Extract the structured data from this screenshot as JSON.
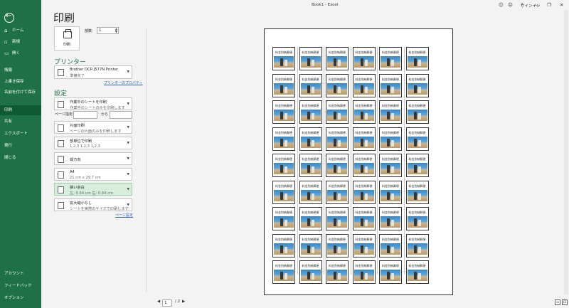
{
  "titlebar": {
    "title": "Book1 - Excel",
    "signin": "サインイン",
    "icons": [
      "smiley-icon",
      "frown-icon",
      "help-icon",
      "minimize-icon",
      "restore-icon",
      "close-icon"
    ],
    "glyphs": [
      "☺",
      "☹",
      "?",
      "—",
      "❐",
      "✕"
    ]
  },
  "sidebar": {
    "back_glyph": "",
    "items": [
      {
        "label": "ホーム",
        "icon": "⌂"
      },
      {
        "label": "新規",
        "icon": "▫"
      },
      {
        "label": "開く",
        "icon": "▭"
      }
    ],
    "items2": [
      {
        "label": "情報"
      },
      {
        "label": "上書き保存"
      },
      {
        "label": "名前を付けて保存"
      },
      {
        "label": "印刷"
      },
      {
        "label": "共有"
      },
      {
        "label": "エクスポート"
      },
      {
        "label": "発行"
      },
      {
        "label": "閉じる"
      }
    ],
    "bottom": [
      {
        "label": "アカウント"
      },
      {
        "label": "フィードバック"
      },
      {
        "label": "オプション"
      }
    ]
  },
  "print": {
    "page_title": "印刷",
    "print_button": "印刷",
    "copies_label": "部数:",
    "copies_value": "1",
    "printer_header": "プリンター",
    "printer_name": "Brother DCP-J577N Printer",
    "printer_status": "準備完了",
    "printer_properties": "プリンターのプロパティ",
    "settings_header": "設定",
    "page_spec_label": "ページ指定:",
    "to_label": "から",
    "settings": [
      {
        "line1": "作業中のシートを印刷",
        "line2": "作業中のシートのみを印刷します"
      },
      {
        "line1": "片面印刷",
        "line2": "ページの片面のみを印刷します"
      },
      {
        "line1": "部単位で印刷",
        "line2": "1,2,3    1,2,3    1,2,3"
      },
      {
        "line1": "縦方向",
        "line2": ""
      },
      {
        "line1": "A4",
        "line2": "21 cm x 29.7 cm"
      },
      {
        "line1": "狭い余白",
        "line2": "左:  0.64 cm    右:  0.64 cm"
      },
      {
        "line1": "拡大縮小なし",
        "line2": "シートを実際のサイズで印刷します"
      }
    ],
    "page_setup_link": "ページ設定"
  },
  "preview": {
    "label_text": "料金別納郵便",
    "rows": 9,
    "cols": 6,
    "current_page": "1",
    "total_pages": "/ 2"
  }
}
